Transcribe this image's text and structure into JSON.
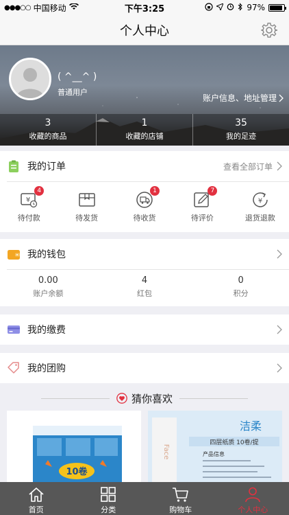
{
  "status_bar": {
    "carrier": "中国移动",
    "time": "下午3:25",
    "battery": "97%"
  },
  "nav": {
    "title": "个人中心"
  },
  "profile": {
    "nickname": "( ^__^ )",
    "user_type": "普通用户",
    "account_link": "账户信息、地址管理",
    "stats": [
      {
        "num": "3",
        "label": "收藏的商品"
      },
      {
        "num": "1",
        "label": "收藏的店铺"
      },
      {
        "num": "35",
        "label": "我的足迹"
      }
    ]
  },
  "orders": {
    "title": "我的订单",
    "view_all": "查看全部订单",
    "items": [
      {
        "label": "待付款",
        "badge": "4"
      },
      {
        "label": "待发货",
        "badge": ""
      },
      {
        "label": "待收货",
        "badge": "1"
      },
      {
        "label": "待评价",
        "badge": "7"
      },
      {
        "label": "退货退款",
        "badge": ""
      }
    ]
  },
  "wallet": {
    "title": "我的钱包",
    "items": [
      {
        "num": "0.00",
        "label": "账户余额"
      },
      {
        "num": "4",
        "label": "红包"
      },
      {
        "num": "0",
        "label": "积分"
      }
    ]
  },
  "payments": {
    "title": "我的缴费"
  },
  "group": {
    "title": "我的团购"
  },
  "guess": {
    "title": "猜你喜欢",
    "products": [
      {
        "badge_text": "10卷"
      },
      {
        "brand": "洁柔",
        "subtitle": "四层纸质  10卷/提",
        "info_title": "产品信息",
        "side_text": "Face"
      }
    ]
  },
  "tabbar": {
    "items": [
      {
        "label": "首页"
      },
      {
        "label": "分类"
      },
      {
        "label": "购物车"
      },
      {
        "label": "个人中心"
      }
    ],
    "active_color": "#e23140"
  },
  "colors": {
    "accent": "#e23140",
    "tabbar_bg": "#575757"
  }
}
